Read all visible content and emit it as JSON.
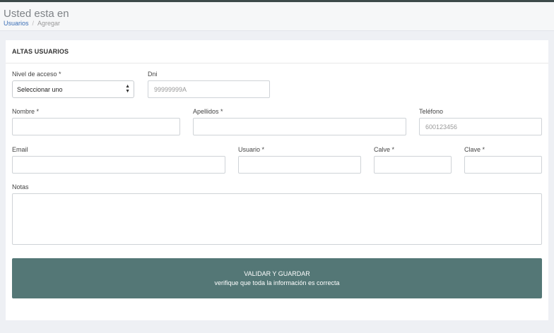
{
  "header": {
    "title": "Usted esta en",
    "breadcrumb": {
      "link": "Usuarios",
      "separator": "/",
      "current": "Agregar"
    }
  },
  "panel": {
    "title": "ALTAS USUARIOS"
  },
  "form": {
    "nivel_acceso": {
      "label": "Nivel de acceso *",
      "value": "Seleccionar uno"
    },
    "dni": {
      "label": "Dni",
      "placeholder": "99999999A",
      "value": ""
    },
    "nombre": {
      "label": "Nombre *",
      "value": ""
    },
    "apellidos": {
      "label": "Apellidos *",
      "value": ""
    },
    "telefono": {
      "label": "Teléfono",
      "placeholder": "600123456",
      "value": ""
    },
    "email": {
      "label": "Email",
      "value": ""
    },
    "usuario": {
      "label": "Usuario *",
      "value": ""
    },
    "calve": {
      "label": "Calve *",
      "value": ""
    },
    "clave": {
      "label": "Clave *",
      "value": ""
    },
    "notas": {
      "label": "Notas",
      "value": ""
    }
  },
  "submit": {
    "line1": "VALIDAR Y GUARDAR",
    "line2": "verifique que toda la información es correcta"
  },
  "colors": {
    "accent": "#547776",
    "link": "#3b6fb6",
    "topbar": "#3d4a4a"
  }
}
